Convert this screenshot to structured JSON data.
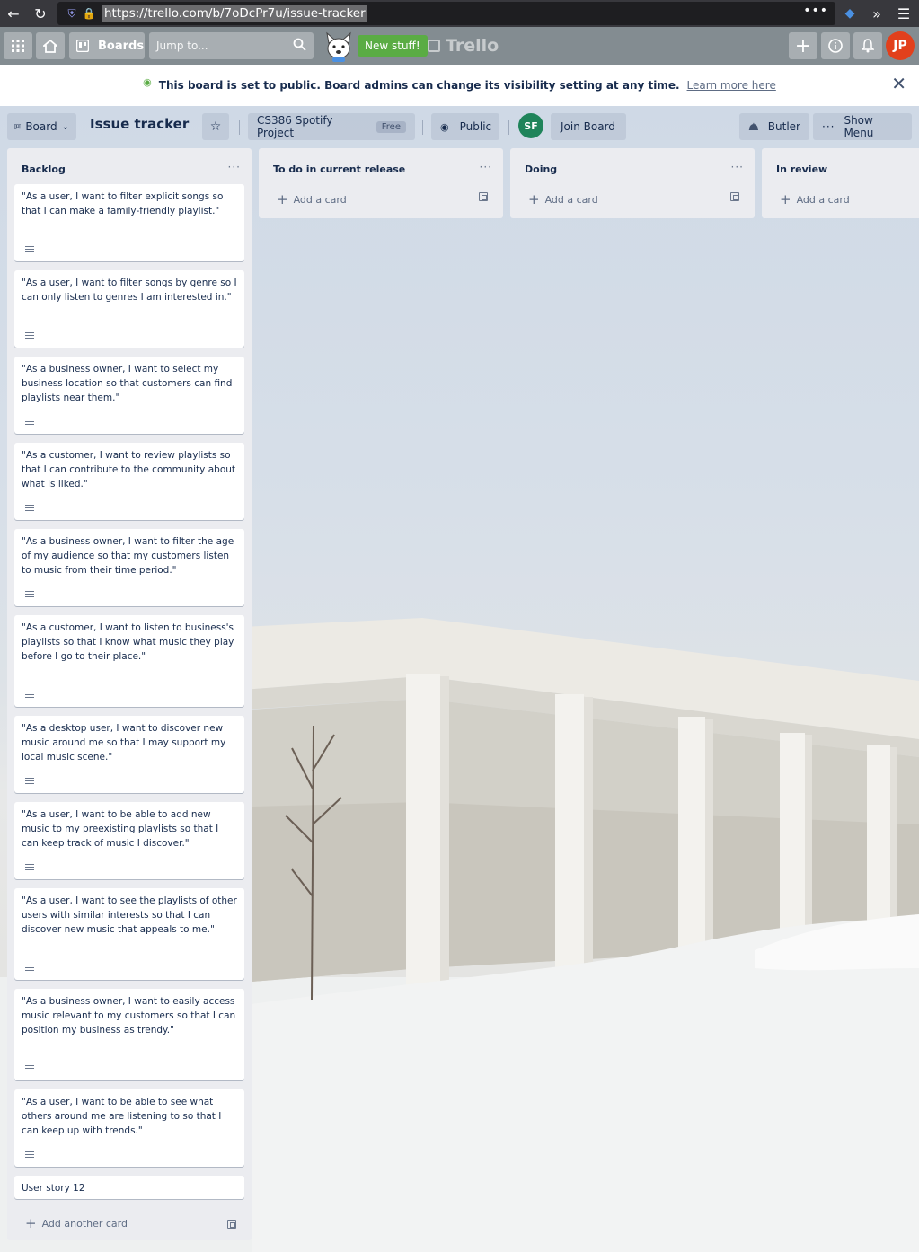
{
  "browser": {
    "url": "https://trello.com/b/7oDcPr7u/issue-tracker",
    "back_icon": "arrow-left",
    "reload_icon": "reload",
    "menu_dots": "•••"
  },
  "header": {
    "boards_label": "Boards",
    "search_placeholder": "Jump to...",
    "new_stuff_label": "New stuff!",
    "logo_text": "Trello",
    "user_initials": "JP"
  },
  "banner": {
    "message": "This board is set to public. Board admins can change its visibility setting at any time.",
    "link": "Learn more here"
  },
  "board_header": {
    "view_label": "Board",
    "title": "Issue tracker",
    "team_name": "CS386 Spotify Project",
    "team_badge": "Free",
    "visibility_label": "Public",
    "member_initials": "SF",
    "join_label": "Join Board",
    "butler_label": "Butler",
    "show_menu_label": "Show Menu"
  },
  "lists": [
    {
      "title": "Backlog",
      "add_label": "Add another card",
      "cards": [
        "\"As a user, I want to filter explicit songs so that I can make a family-friendly playlist.\"",
        "\"As a user, I want to filter songs by genre so I can only listen to genres I am interested in.\"",
        "\"As a business owner, I want to select my business location so that customers can find playlists near them.\"",
        "\"As a customer, I want to review playlists so that I can contribute to the community about what is liked.\"",
        "\"As a business owner, I want to filter the age of my audience so that my customers listen to music from their time period.\"",
        "\"As a customer, I want to listen to business's playlists so that I know what music they play before I go to their place.\"",
        "\"As a desktop user, I want to discover new music around me so that I may support my local music scene.\"",
        "\"As a user, I want to be able to add new music to my preexisting playlists so that I can keep track of music I discover.\"",
        "\"As a user, I want to see the playlists of other users with similar interests so that I can discover new music that appeals to me.\"",
        "\"As a business owner, I want to easily access music relevant to my customers so that I can position my business as trendy.\"",
        "\"As a user, I want to be able to see what others around me are listening to so that I can keep up with trends.\"",
        "User story 12"
      ]
    },
    {
      "title": "To do in current release",
      "add_label": "Add a card"
    },
    {
      "title": "Doing",
      "add_label": "Add a card"
    },
    {
      "title": "In review",
      "add_label": "Add a card"
    }
  ]
}
